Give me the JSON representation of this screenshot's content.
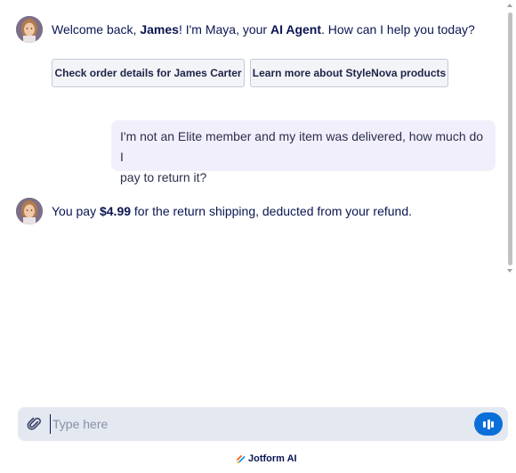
{
  "agent": {
    "name": "Maya",
    "avatar_icon": "agent-avatar-icon"
  },
  "messages": {
    "welcome": {
      "prefix": "Welcome back, ",
      "user_name": "James",
      "middle": "! I'm Maya, your ",
      "agent_label": "AI Agent",
      "suffix": ". How can I help you today?"
    },
    "suggestions": [
      {
        "label": "Check order details for James Carter"
      },
      {
        "label": "Learn more about StyleNova products"
      }
    ],
    "user": {
      "line1": "I'm not an Elite member and my item was delivered, how much do I",
      "line2": "pay to return it?"
    },
    "answer": {
      "prefix": "You pay ",
      "amount": "$4.99",
      "suffix": " for the return shipping, deducted from your refund."
    }
  },
  "composer": {
    "placeholder": "Type here",
    "attach_icon": "paperclip-icon",
    "voice_icon": "voice-wave-icon"
  },
  "footer": {
    "brand": "Jotform AI"
  },
  "colors": {
    "text": "#0a1551",
    "user_bubble": "#f2effd",
    "accent": "#0a6fd8",
    "composer_bg": "#e4e8f0"
  }
}
